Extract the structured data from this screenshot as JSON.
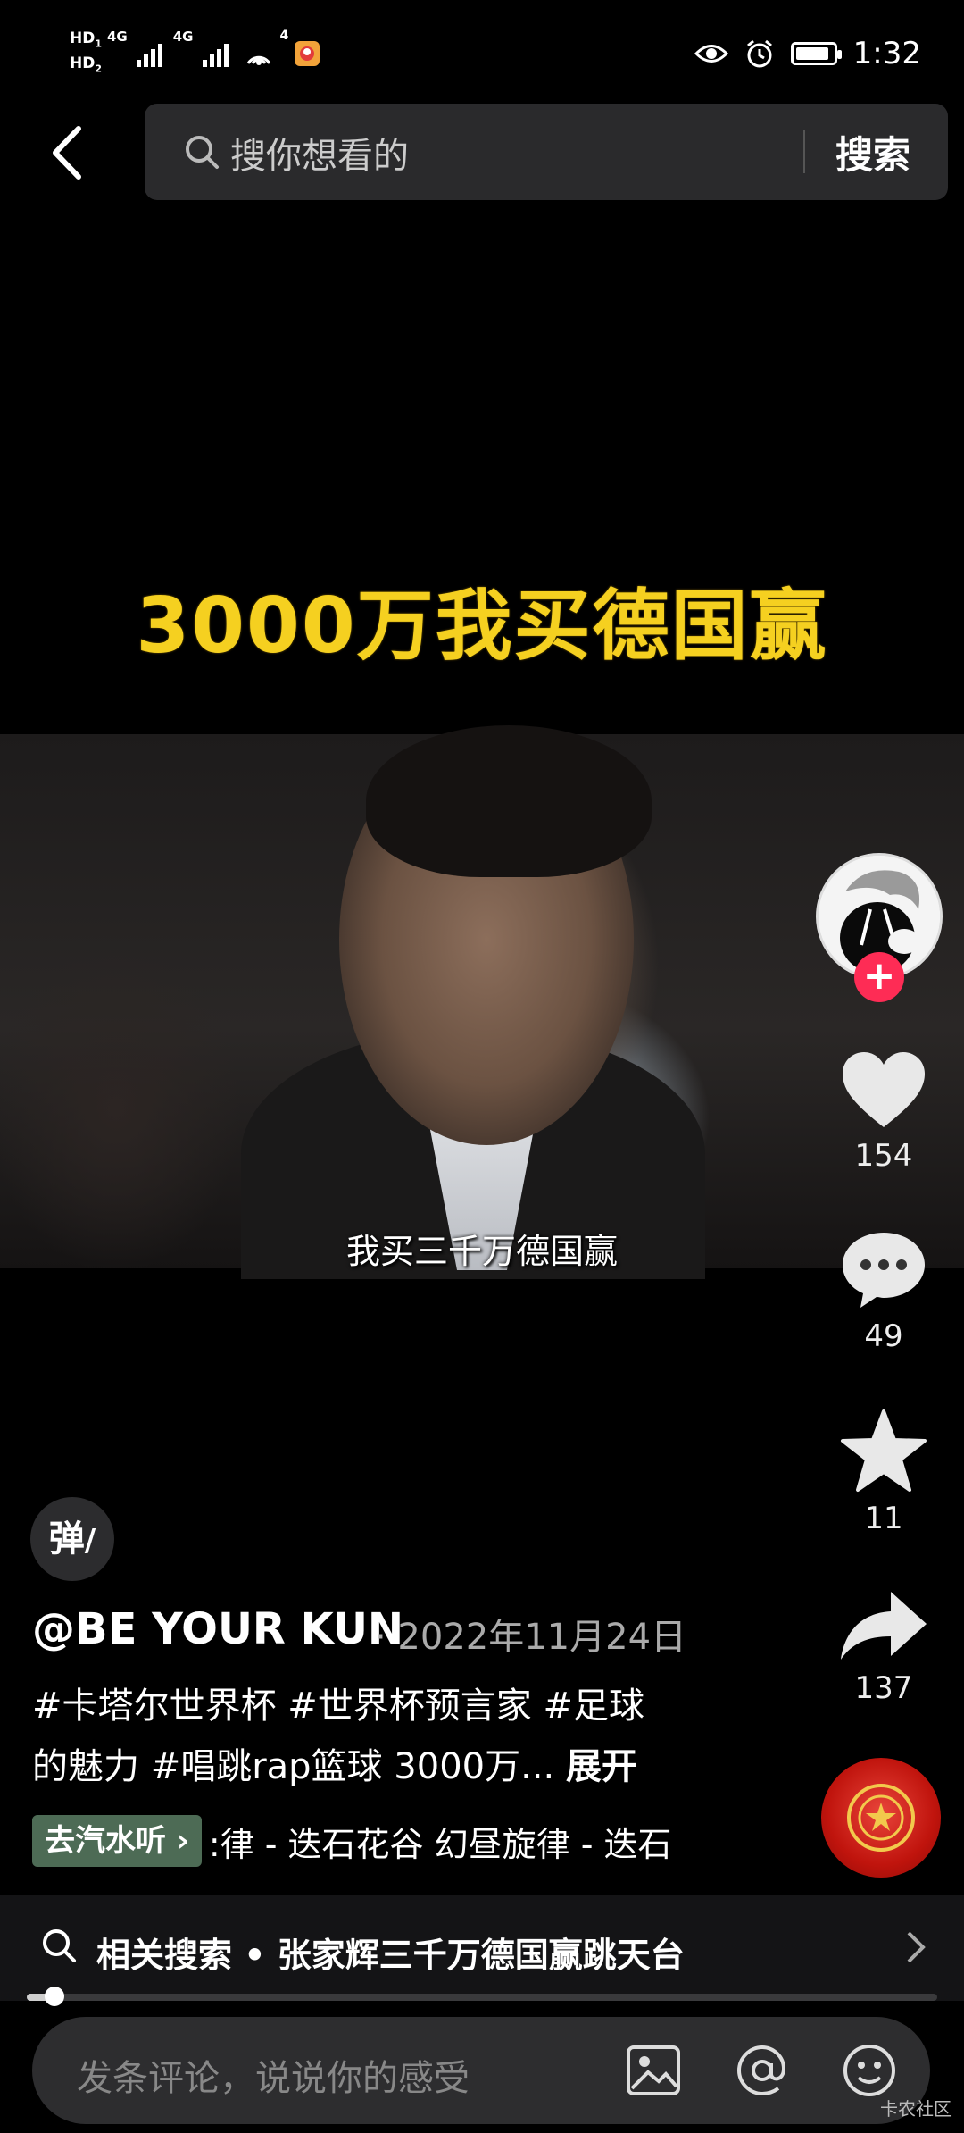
{
  "status_bar": {
    "hd1": "HD",
    "hd2": "HD",
    "sim1": "1",
    "sim2": "2",
    "net1": "4G",
    "net2": "4G",
    "hotspot_count": "4",
    "time": "1:32",
    "icons": [
      "eye-icon",
      "alarm-icon",
      "battery-icon"
    ]
  },
  "search": {
    "placeholder": "搜你想看的",
    "button": "搜索"
  },
  "video": {
    "overlay_caption": "3000万我买德国赢",
    "subtitle": "我买三千万德国赢"
  },
  "actions": {
    "likes": "154",
    "comments": "49",
    "favorites": "11",
    "shares": "137",
    "follow_symbol": "+"
  },
  "post": {
    "danmu_label": "弹",
    "author": "@BE YOUR KUN",
    "date": "· 2022年11月24日",
    "description_line1": "#卡塔尔世界杯 #世界杯预言家 #足球",
    "description_line2": "的魅力 #唱跳rap篮球 3000万...",
    "expand": "展开",
    "music_chip": "去汽水听 ›",
    "music_text": ":律 - 迭石花谷    幻昼旋律 - 迭石"
  },
  "related_search": {
    "text": "相关搜索 • 张家辉三千万德国赢跳天台"
  },
  "playback": {
    "progress": 0.03
  },
  "comment_bar": {
    "placeholder": "发条评论，说说你的感受"
  },
  "watermark": "卡农社区"
}
